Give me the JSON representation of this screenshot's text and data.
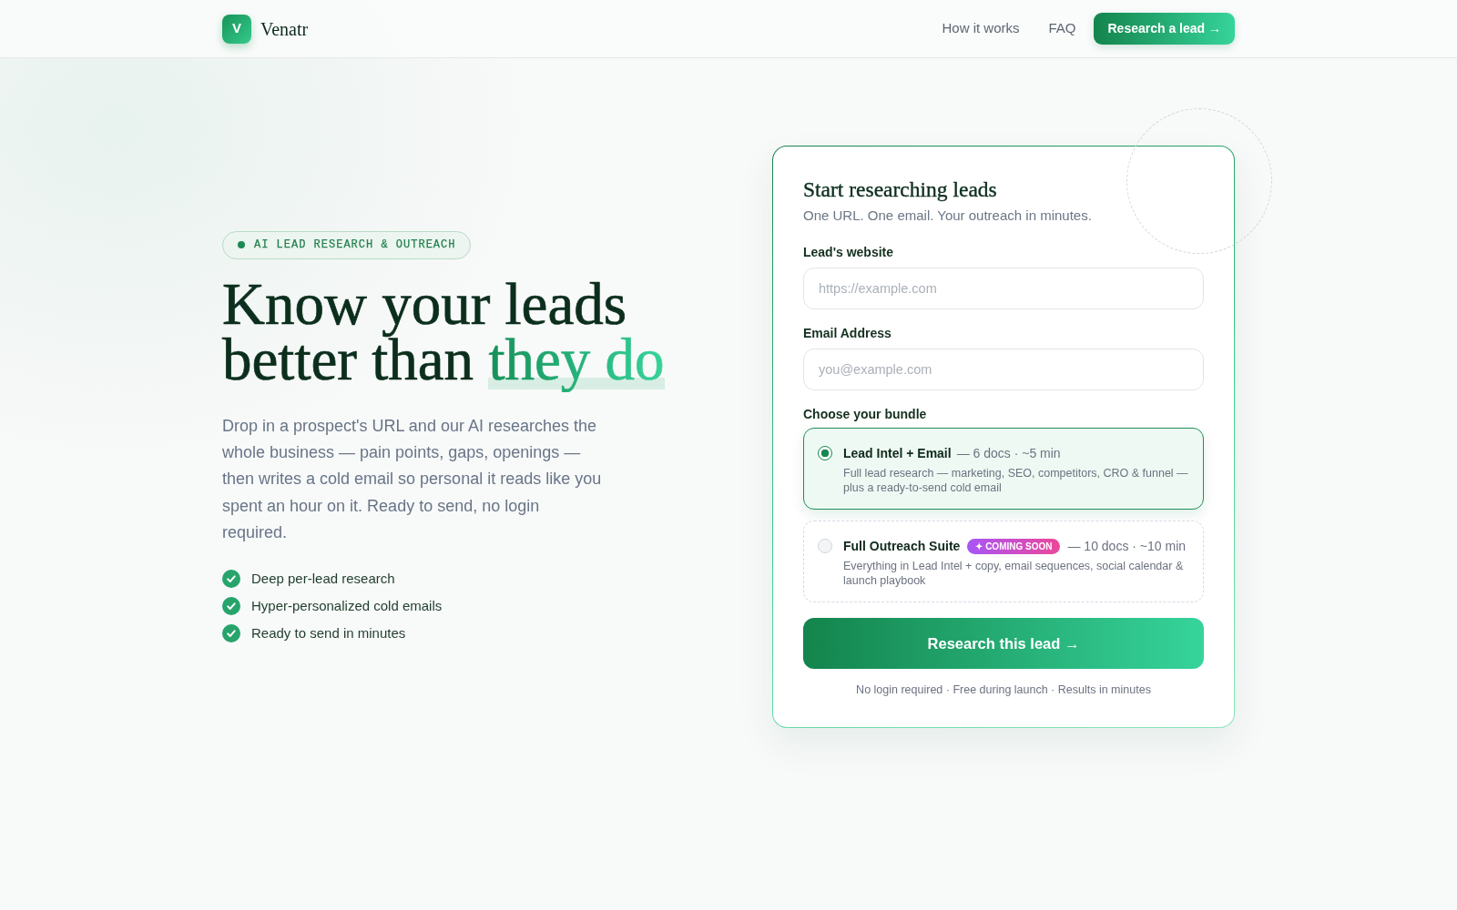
{
  "header": {
    "logo_letter": "V",
    "brand": "Venatr",
    "nav_links": [
      "How it works",
      "FAQ"
    ],
    "cta": "Research a lead →"
  },
  "hero": {
    "eyebrow": "AI LEAD RESEARCH & OUTREACH",
    "headline": "Know your leads better than",
    "headline_highlight": "they do",
    "description": "Drop in a prospect's URL and our AI researches the whole business — pain points, gaps, openings — then writes a cold email so personal it reads like you spent an hour on it. Ready to send, no login required.",
    "features": [
      "Deep per-lead research",
      "Hyper-personalized cold emails",
      "Ready to send in minutes"
    ]
  },
  "form": {
    "title": "Start researching leads",
    "subtitle": "One URL. One email. Your outreach in minutes.",
    "fields": [
      {
        "label": "Lead's website",
        "placeholder": "https://example.com"
      },
      {
        "label": "Email Address",
        "placeholder": "you@example.com"
      }
    ],
    "bundle_label": "Choose your bundle",
    "bundles": [
      {
        "name": "Lead Intel + Email",
        "meta": "— 6 docs · ~5 min",
        "description": "Full lead research — marketing, SEO, competitors, CRO & funnel — plus a ready-to-send cold email",
        "selected": true,
        "disabled": false
      },
      {
        "name": "Full Outreach Suite",
        "badge": "✦ COMING SOON",
        "meta": "— 10 docs · ~10 min",
        "description": "Everything in Lead Intel + copy, email sequences, social calendar & launch playbook",
        "selected": false,
        "disabled": true
      }
    ],
    "submit": "Research this lead →",
    "footnote": "No login required · Free during launch · Results in minutes"
  }
}
